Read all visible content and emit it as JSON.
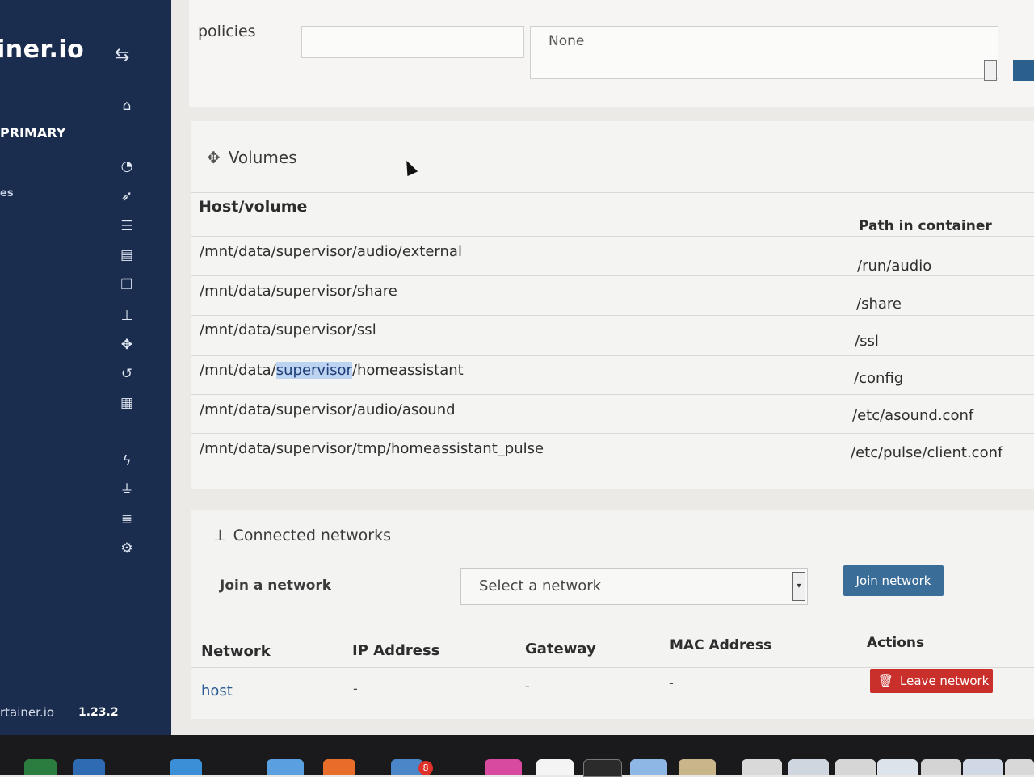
{
  "sidebar": {
    "brand": "iner.io",
    "primary_label": "PRIMARY",
    "fragment": "es",
    "footer_brand": "rtainer.io",
    "version": "1.23.2",
    "icons": [
      "home-icon",
      "dashboard-icon",
      "app-templates-icon",
      "stacks-icon",
      "containers-icon",
      "images-icon",
      "networks-icon",
      "volumes-icon",
      "events-icon",
      "host-icon",
      "extensions-icon",
      "endpoints-icon",
      "registries-icon",
      "settings-icon"
    ]
  },
  "policies": {
    "label": "policies",
    "select_value": "None"
  },
  "volumes": {
    "title": "Volumes",
    "headers": {
      "host": "Host/volume",
      "path": "Path in container"
    },
    "rows": [
      {
        "host": "/mnt/data/supervisor/audio/external",
        "path": "/run/audio"
      },
      {
        "host": "/mnt/data/supervisor/share",
        "path": "/share"
      },
      {
        "host": "/mnt/data/supervisor/ssl",
        "path": "/ssl"
      },
      {
        "host_pre": "/mnt/data/",
        "host_hl": "supervisor",
        "host_post": "/homeassistant",
        "path": "/config"
      },
      {
        "host": "/mnt/data/supervisor/audio/asound",
        "path": "/etc/asound.conf"
      },
      {
        "host": "/mnt/data/supervisor/tmp/homeassistant_pulse",
        "path": "/etc/pulse/client.conf"
      }
    ]
  },
  "networks": {
    "title": "Connected networks",
    "join_label": "Join a network",
    "select_placeholder": "Select a network",
    "join_button": "Join network",
    "headers": {
      "network": "Network",
      "ip": "IP Address",
      "gateway": "Gateway",
      "mac": "MAC Address",
      "actions": "Actions"
    },
    "row": {
      "network": "host",
      "ip": "-",
      "gateway": "-",
      "mac": "-",
      "action": "Leave network"
    }
  },
  "dock": {
    "badge": "8"
  }
}
